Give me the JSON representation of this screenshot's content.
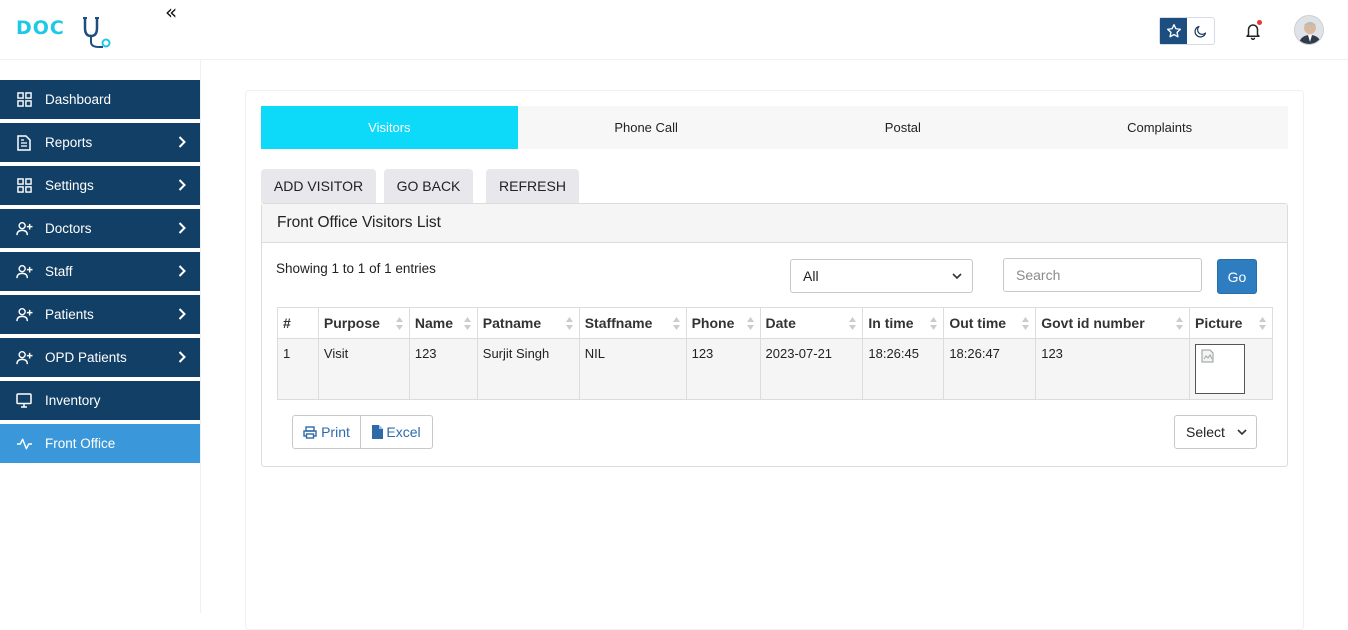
{
  "header": {
    "logo_text": "DOC",
    "collapse_glyph": "«",
    "icons": {
      "theme_light": "star-icon",
      "theme_dark": "moon-icon",
      "notifications": "bell-icon",
      "profile": "avatar"
    }
  },
  "sidebar": {
    "items": [
      {
        "label": "Dashboard",
        "icon": "grid-icon",
        "has_children": false
      },
      {
        "label": "Reports",
        "icon": "document-icon",
        "has_children": true
      },
      {
        "label": "Settings",
        "icon": "grid-icon",
        "has_children": true
      },
      {
        "label": "Doctors",
        "icon": "user-plus-icon",
        "has_children": true
      },
      {
        "label": "Staff",
        "icon": "user-plus-icon",
        "has_children": true
      },
      {
        "label": "Patients",
        "icon": "user-plus-icon",
        "has_children": true
      },
      {
        "label": "OPD Patients",
        "icon": "user-plus-icon",
        "has_children": true
      },
      {
        "label": "Inventory",
        "icon": "monitor-icon",
        "has_children": false
      },
      {
        "label": "Front Office",
        "icon": "pulse-icon",
        "has_children": false,
        "active": true
      }
    ]
  },
  "tabs": [
    {
      "label": "Visitors",
      "active": true
    },
    {
      "label": "Phone Call"
    },
    {
      "label": "Postal"
    },
    {
      "label": "Complaints"
    }
  ],
  "actions": {
    "add_visitor": "ADD VISITOR",
    "go_back": "GO BACK",
    "refresh": "REFRESH"
  },
  "panel": {
    "title": "Front Office Visitors List",
    "showing": "Showing 1 to 1 of 1 entries",
    "filter_value": "All",
    "search_placeholder": "Search",
    "go_label": "Go",
    "columns": [
      "#",
      "Purpose",
      "Name",
      "Patname",
      "Staffname",
      "Phone",
      "Date",
      "In time",
      "Out time",
      "Govt id number",
      "Picture"
    ],
    "rows": [
      {
        "num": "1",
        "purpose": "Visit",
        "name": "123",
        "patname": "Surjit Singh",
        "staffname": "NIL",
        "phone": "123",
        "date": "2023-07-21",
        "in_time": "18:26:45",
        "out_time": "18:26:47",
        "govt_id": "123",
        "picture": "broken-image-icon"
      }
    ],
    "print_label": "Print",
    "excel_label": "Excel",
    "page_select": "Select"
  },
  "colors": {
    "sidebar_bg": "#123f66",
    "sidebar_active": "#3a98da",
    "tab_active": "#0ddaf9",
    "logo": "#1ec8e8",
    "go_button": "#2e7dc0"
  }
}
